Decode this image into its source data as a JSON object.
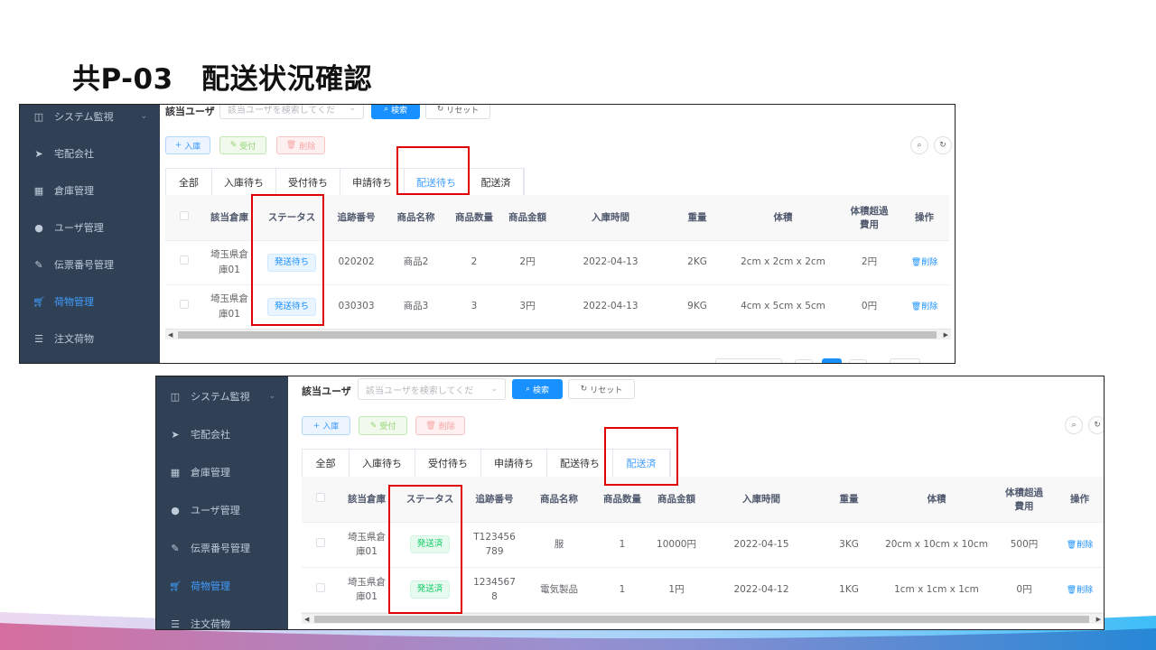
{
  "title": "共P-03　配送状況確認",
  "sidebar": {
    "items": [
      {
        "label": "システム監視",
        "icon": "monitor-icon",
        "chevron": "⌄"
      },
      {
        "label": "宅配会社",
        "icon": "send-icon"
      },
      {
        "label": "倉庫管理",
        "icon": "grid-icon"
      },
      {
        "label": "ユーザ管理",
        "icon": "user-icon"
      },
      {
        "label": "伝票番号管理",
        "icon": "edit-icon"
      },
      {
        "label": "荷物管理",
        "icon": "cart-icon",
        "active": true
      },
      {
        "label": "注文荷物",
        "icon": "list-icon"
      }
    ]
  },
  "filter": {
    "label": "該当ユーザ",
    "placeholder": "該当ユーザを検索してくだ",
    "search_label": "検索",
    "reset_label": "リセット"
  },
  "actions": {
    "add": "入庫",
    "accept": "受付",
    "delete": "削除"
  },
  "tabs": [
    "全部",
    "入庫待ち",
    "受付待ち",
    "申請待ち",
    "配送待ち",
    "配送済"
  ],
  "columns": [
    "該当倉庫",
    "ステータス",
    "追跡番号",
    "商品名称",
    "商品数量",
    "商品金額",
    "入庫時間",
    "重量",
    "体積",
    "体積超過\n費用",
    "操作"
  ],
  "row_action": "削除",
  "screenshot1": {
    "active_tab": "配送待ち",
    "rows": [
      {
        "warehouse": "埼玉県倉\n庫01",
        "status": "発送待ち",
        "tracking": "020202",
        "product": "商品2",
        "qty": "2",
        "amount": "2円",
        "time": "2022-04-13",
        "weight": "2KG",
        "volume": "2cm x 2cm x 2cm",
        "over_fee": "2円"
      },
      {
        "warehouse": "埼玉県倉\n庫01",
        "status": "発送待ち",
        "tracking": "030303",
        "product": "商品3",
        "qty": "3",
        "amount": "3円",
        "time": "2022-04-13",
        "weight": "9KG",
        "volume": "4cm x 5cm x 5cm",
        "over_fee": "0円"
      }
    ]
  },
  "screenshot2": {
    "active_tab": "配送済",
    "rows": [
      {
        "warehouse": "埼玉県倉\n庫01",
        "status": "発送済",
        "tracking": "T123456\n789",
        "product": "服",
        "qty": "1",
        "amount": "10000円",
        "time": "2022-04-15",
        "weight": "3KG",
        "volume": "20cm x 10cm x 10cm",
        "over_fee": "500円"
      },
      {
        "warehouse": "埼玉県倉\n庫01",
        "status": "発送済",
        "tracking": "1234567\n8",
        "product": "電気製品",
        "qty": "1",
        "amount": "1円",
        "time": "2022-04-12",
        "weight": "1KG",
        "volume": "1cm x 1cm x 1cm",
        "over_fee": "0円"
      }
    ]
  },
  "colors": {
    "sidebar_bg": "#304156",
    "primary": "#1890ff",
    "highlight": "#e00000",
    "tag_green": "#13ce66"
  }
}
